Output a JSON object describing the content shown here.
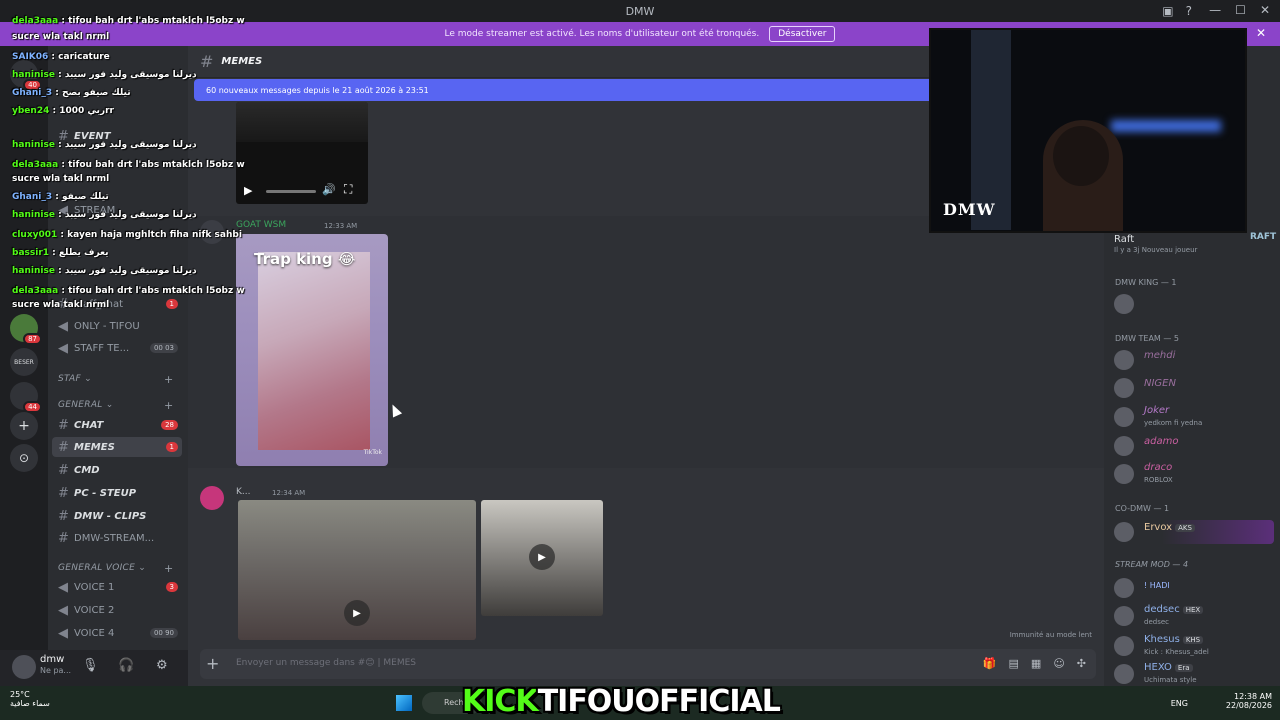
{
  "window": {
    "title": "DMW"
  },
  "banner": {
    "text": "Le mode streamer est activé. Les noms d'utilisateur ont été tronqués.",
    "button": "Désactiver"
  },
  "servers": [
    {
      "badge": "40"
    },
    {
      "badge": "87"
    },
    {
      "label": "BESER"
    },
    {
      "badge": "44"
    }
  ],
  "channels": {
    "items": [
      {
        "name": "EVENT"
      },
      {
        "name": "STREAM"
      },
      {
        "name": "staff_chat",
        "count": "1"
      },
      {
        "name": "ONLY - TIFOU"
      },
      {
        "name": "STAFF TE...",
        "count": "00 03"
      },
      {
        "name": "CHAT",
        "count": "28"
      },
      {
        "name": "MEMES",
        "count": "1"
      },
      {
        "name": "CMD"
      },
      {
        "name": "PC - STEUP"
      },
      {
        "name": "DMW - CLIPS"
      },
      {
        "name": "DMW-STREAM..."
      },
      {
        "name": "VOICE 1",
        "count": "3"
      },
      {
        "name": "VOICE 2"
      },
      {
        "name": "VOICE 4",
        "count": "00 90"
      }
    ],
    "categories": {
      "staf": "STAF",
      "general": "GENERAL",
      "general_voice": "GENERAL VOICE"
    }
  },
  "user": {
    "name": "dmw",
    "status": "Ne pa..."
  },
  "chat": {
    "channel_title": "MEMES",
    "new_messages": "60 nouveaux messages depuis le 21 août 2026 à 23:51",
    "msg1": {
      "author": "GOAT WSM",
      "time": "12:33 AM",
      "caption": "Trap king 😂",
      "watermark": "TikTok"
    },
    "msg2": {
      "author": "K...",
      "time": "12:34 AM"
    },
    "slowmode": "Immunité au mode lent",
    "placeholder": "Envoyer un message dans #😊 | MEMES"
  },
  "members": {
    "top": {
      "name": "Raft",
      "sub": "Il y a 3j  Nouveau joueur",
      "badge": "RAFT"
    },
    "cat_king": "DMW KING — 1",
    "cat_team": "DMW TEAM — 5",
    "team": [
      {
        "name": "mehdi",
        "color": "#9a6f9e"
      },
      {
        "name": "NIGEN",
        "color": "#9a6f9e"
      },
      {
        "name": "Joker",
        "sub": "yedkom fi yedna",
        "color": "#b579c9"
      },
      {
        "name": "adamo",
        "color": "#c85fa0"
      },
      {
        "name": "draco",
        "sub": "ROBLOX",
        "color": "#c85fa0"
      }
    ],
    "cat_codmw": "CO-DMW — 1",
    "codmw": {
      "name": "Ervox",
      "tag": "AKS"
    },
    "cat_streammod": "STREAM MOD — 4",
    "mods": [
      {
        "name": "! HADI",
        "sub": "",
        "tag": ""
      },
      {
        "name": "dedsec",
        "sub": "dedsec",
        "tag": "HEX"
      },
      {
        "name": "Khesus",
        "sub": "Kick : Khesus_adel",
        "tag": "KHS"
      },
      {
        "name": "HEXO",
        "sub": "Uchimata style",
        "tag": "Era"
      }
    ]
  },
  "cam": {
    "logo": "DMW"
  },
  "overlay": {
    "lines": [
      {
        "user": "dela3aaa",
        "text": "tifou bah drt l'abs mtaklch l5obz w"
      },
      {
        "user": "",
        "text": "sucre wla takl nrml"
      },
      {
        "user": "SAIK06",
        "text": "caricature"
      },
      {
        "user": "haninise",
        "text": "ديرلنا موسيقى وليد فور سيبد"
      },
      {
        "user": "Ghani_3",
        "text": "تيلك صيفو بصح"
      },
      {
        "user": "yben24",
        "text": "ربي 1000rr"
      },
      {
        "user": "haninise",
        "text": "ديرلنا موسيقى وليد فور سيبد"
      },
      {
        "user": "dela3aaa",
        "text": "tifou bah drt l'abs mtaklch l5obz w"
      },
      {
        "user": "",
        "text": "sucre wla takl nrml"
      },
      {
        "user": "Ghani_3",
        "text": "تيلك صيفو"
      },
      {
        "user": "haninise",
        "text": "ديرلنا موسيقى وليد فور سيبد"
      },
      {
        "user": "cluxy001",
        "text": "kayen haja mghltch fiha nifk sahbi"
      },
      {
        "user": "bassir1",
        "text": "يعرف يطلع"
      },
      {
        "user": "haninise",
        "text": "ديرلنا موسيقى وليد فور سيبد"
      },
      {
        "user": "dela3aaa",
        "text": "tifou bah drt l'abs mtaklch l5obz w"
      },
      {
        "user": "",
        "text": "sucre wla takl nrml"
      }
    ]
  },
  "taskbar": {
    "temp": "25°C",
    "weather": "سماء صافية",
    "search": "Rech",
    "lang": "ENG",
    "time": "12:38 AM",
    "date": "22/08/2026"
  },
  "kick_banner": {
    "prefix": "KICK",
    "name": "TIFOUOFFICIAL"
  }
}
